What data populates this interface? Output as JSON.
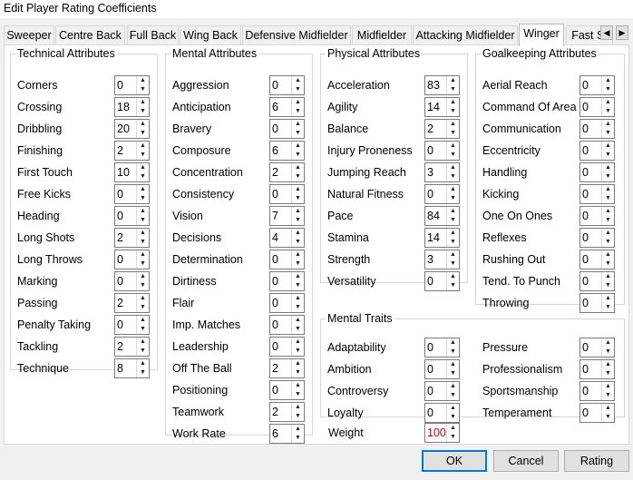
{
  "window": {
    "title": "Edit Player Rating Coefficients"
  },
  "tabs": [
    {
      "label": "Sweeper"
    },
    {
      "label": "Centre Back"
    },
    {
      "label": "Full Back"
    },
    {
      "label": "Wing Back"
    },
    {
      "label": "Defensive Midfielder"
    },
    {
      "label": "Midfielder"
    },
    {
      "label": "Attacking Midfielder"
    },
    {
      "label": "Winger"
    },
    {
      "label": "Fast St"
    }
  ],
  "active_tab": "Winger",
  "tab_scroll": {
    "left_icon": "chevron-left-icon",
    "right_icon": "chevron-right-icon"
  },
  "spin_icons": {
    "up": "▲",
    "down": "▼"
  },
  "groups": [
    {
      "key": "technical",
      "legend": "Technical Attributes",
      "items": [
        {
          "label": "Corners",
          "value": "0"
        },
        {
          "label": "Crossing",
          "value": "18"
        },
        {
          "label": "Dribbling",
          "value": "20"
        },
        {
          "label": "Finishing",
          "value": "2"
        },
        {
          "label": "First Touch",
          "value": "10"
        },
        {
          "label": "Free Kicks",
          "value": "0"
        },
        {
          "label": "Heading",
          "value": "0"
        },
        {
          "label": "Long Shots",
          "value": "2"
        },
        {
          "label": "Long Throws",
          "value": "0"
        },
        {
          "label": "Marking",
          "value": "0"
        },
        {
          "label": "Passing",
          "value": "2"
        },
        {
          "label": "Penalty Taking",
          "value": "0"
        },
        {
          "label": "Tackling",
          "value": "2"
        },
        {
          "label": "Technique",
          "value": "8"
        }
      ]
    },
    {
      "key": "mental",
      "legend": "Mental Attributes",
      "items": [
        {
          "label": "Aggression",
          "value": "0"
        },
        {
          "label": "Anticipation",
          "value": "6"
        },
        {
          "label": "Bravery",
          "value": "0"
        },
        {
          "label": "Composure",
          "value": "6"
        },
        {
          "label": "Concentration",
          "value": "2"
        },
        {
          "label": "Consistency",
          "value": "0"
        },
        {
          "label": "Vision",
          "value": "7"
        },
        {
          "label": "Decisions",
          "value": "4"
        },
        {
          "label": "Determination",
          "value": "0"
        },
        {
          "label": "Dirtiness",
          "value": "0"
        },
        {
          "label": "Flair",
          "value": "0"
        },
        {
          "label": "Imp. Matches",
          "value": "0"
        },
        {
          "label": "Leadership",
          "value": "0"
        },
        {
          "label": "Off The Ball",
          "value": "2"
        },
        {
          "label": "Positioning",
          "value": "0"
        },
        {
          "label": "Teamwork",
          "value": "2"
        },
        {
          "label": "Work Rate",
          "value": "6"
        }
      ]
    },
    {
      "key": "physical",
      "legend": "Physical Attributes",
      "items": [
        {
          "label": "Acceleration",
          "value": "83"
        },
        {
          "label": "Agility",
          "value": "14"
        },
        {
          "label": "Balance",
          "value": "2"
        },
        {
          "label": "Injury Proneness",
          "value": "0"
        },
        {
          "label": "Jumping Reach",
          "value": "3"
        },
        {
          "label": "Natural Fitness",
          "value": "0"
        },
        {
          "label": "Pace",
          "value": "84"
        },
        {
          "label": "Stamina",
          "value": "14"
        },
        {
          "label": "Strength",
          "value": "3"
        },
        {
          "label": "Versatility",
          "value": "0"
        }
      ]
    },
    {
      "key": "goalkeeping",
      "legend": "Goalkeeping Attributes",
      "items": [
        {
          "label": "Aerial Reach",
          "value": "0"
        },
        {
          "label": "Command Of Area",
          "value": "0"
        },
        {
          "label": "Communication",
          "value": "0"
        },
        {
          "label": "Eccentricity",
          "value": "0"
        },
        {
          "label": "Handling",
          "value": "0"
        },
        {
          "label": "Kicking",
          "value": "0"
        },
        {
          "label": "One On Ones",
          "value": "0"
        },
        {
          "label": "Reflexes",
          "value": "0"
        },
        {
          "label": "Rushing Out",
          "value": "0"
        },
        {
          "label": "Tend. To Punch",
          "value": "0"
        },
        {
          "label": "Throwing",
          "value": "0"
        }
      ]
    },
    {
      "key": "traits",
      "legend": "Mental Traits",
      "items": [
        {
          "label": "Adaptability",
          "value": "0"
        },
        {
          "label": "Pressure",
          "value": "0"
        },
        {
          "label": "Ambition",
          "value": "0"
        },
        {
          "label": "Professionalism",
          "value": "0"
        },
        {
          "label": "Controversy",
          "value": "0"
        },
        {
          "label": "Sportsmanship",
          "value": "0"
        },
        {
          "label": "Loyalty",
          "value": "0"
        },
        {
          "label": "Temperament",
          "value": "0"
        }
      ]
    }
  ],
  "weight": {
    "label": "Weight",
    "value": "100",
    "value_color": "#c00000"
  },
  "buttons": {
    "ok": "OK",
    "cancel": "Cancel",
    "rating": "Rating"
  },
  "colors": {
    "default_button_border": "#0078d7"
  }
}
